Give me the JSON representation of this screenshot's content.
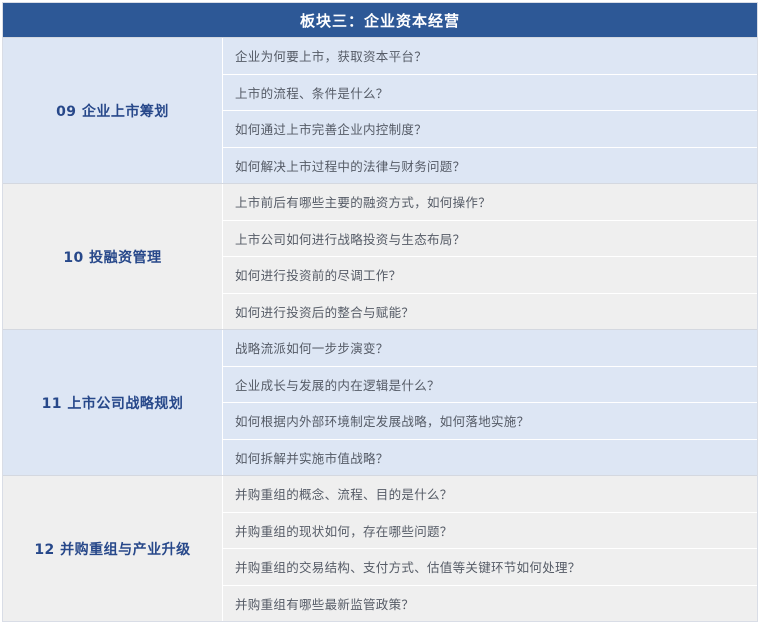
{
  "header": {
    "title": "板块三：企业资本经营"
  },
  "sections": [
    {
      "title": "09 企业上市筹划",
      "items": [
        "企业为何要上市，获取资本平台？",
        "上市的流程、条件是什么？",
        "如何通过上市完善企业内控制度？",
        "如何解决上市过程中的法律与财务问题？"
      ]
    },
    {
      "title": "10 投融资管理",
      "items": [
        "上市前后有哪些主要的融资方式，如何操作？",
        "上市公司如何进行战略投资与生态布局？",
        "如何进行投资前的尽调工作？",
        "如何进行投资后的整合与赋能？"
      ]
    },
    {
      "title": "11 上市公司战略规划",
      "items": [
        "战略流派如何一步步演变？",
        "企业成长与发展的内在逻辑是什么？",
        "如何根据内外部环境制定发展战略，如何落地实施？",
        "如何拆解并实施市值战略？"
      ]
    },
    {
      "title": "12 并购重组与产业升级",
      "items": [
        "并购重组的概念、流程、目的是什么？",
        "并购重组的现状如何，存在哪些问题？",
        "并购重组的交易结构、支付方式、估值等关键环节如何处理？",
        "并购重组有哪些最新监管政策？"
      ]
    }
  ]
}
